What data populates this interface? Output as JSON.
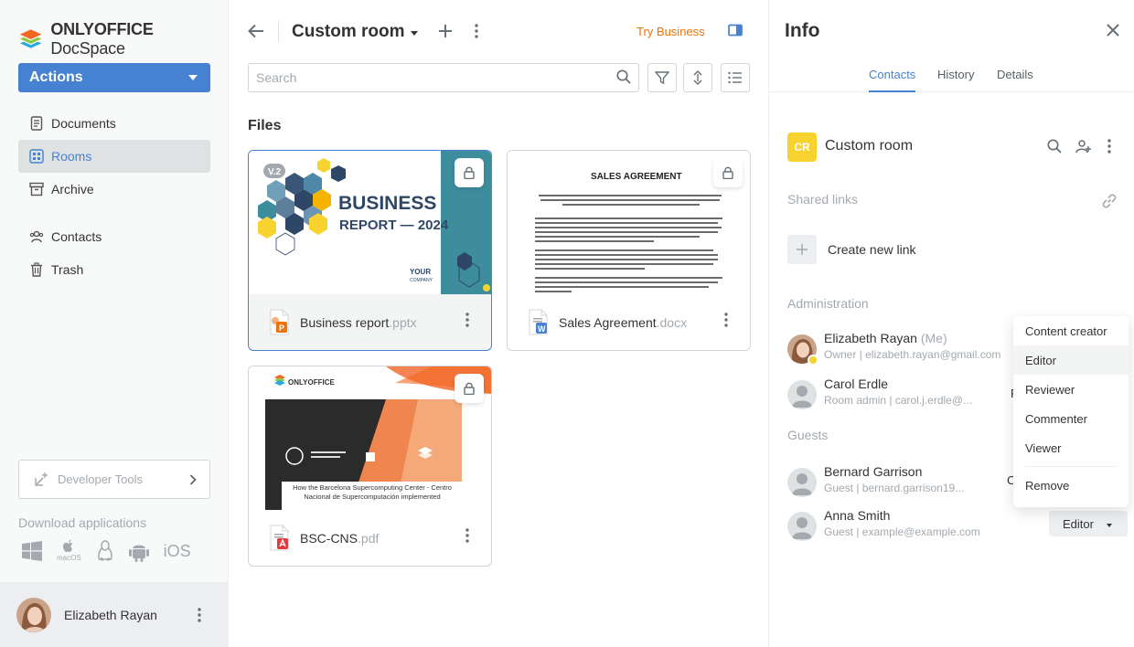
{
  "sidebar": {
    "brand_bold": "ONLYOFFICE",
    "brand_light": "DocSpace",
    "actions_label": "Actions",
    "nav": [
      {
        "label": "Documents",
        "icon": "document-icon"
      },
      {
        "label": "Rooms",
        "icon": "rooms-icon"
      },
      {
        "label": "Archive",
        "icon": "archive-icon"
      },
      {
        "label": "Contacts",
        "icon": "contacts-icon"
      },
      {
        "label": "Trash",
        "icon": "trash-icon"
      }
    ],
    "developer_tools": "Developer Tools",
    "download_label": "Download applications",
    "apps": [
      "windows",
      "macOS",
      "linux",
      "android",
      "iOS"
    ],
    "user_name": "Elizabeth Rayan"
  },
  "main": {
    "room_title": "Custom room",
    "try_business": "Try Business",
    "search_placeholder": "Search",
    "files_heading": "Files",
    "files": [
      {
        "name": "Business report",
        "ext": ".pptx",
        "version": "V.2",
        "thumb": {
          "title1": "BUSINESS",
          "title2": "REPORT — 2024",
          "company1": "YOUR",
          "company2": "COMPANY"
        }
      },
      {
        "name": "Sales Agreement",
        "ext": ".docx",
        "thumb": {
          "title": "SALES AGREEMENT"
        }
      },
      {
        "name": "BSC-CNS",
        "ext": ".pdf",
        "thumb": {
          "logo": "ONLYOFFICE",
          "caption": "How the Barcelona Supercomputing Center - Centro Nacional de Supercomputación implemented"
        }
      }
    ]
  },
  "info": {
    "title": "Info",
    "tabs": [
      "Contacts",
      "History",
      "Details"
    ],
    "room_initials": "CR",
    "room_name": "Custom room",
    "shared_links_title": "Shared links",
    "create_link": "Create new link",
    "administration_title": "Administration",
    "guests_title": "Guests",
    "members": [
      {
        "name": "Elizabeth Rayan",
        "me": "(Me)",
        "sub": "Owner | elizabeth.rayan@gmail.com"
      },
      {
        "name": "Carol Erdle",
        "sub": "Room admin | carol.j.erdle@..."
      },
      {
        "name": "Bernard Garrison",
        "sub": "Guest | bernard.garrison19..."
      },
      {
        "name": "Anna Smith",
        "sub": "Guest | example@example.com"
      }
    ],
    "role_selected": "Editor",
    "peek_letters": [
      "F",
      "C"
    ]
  },
  "role_menu": [
    "Content creator",
    "Editor",
    "Reviewer",
    "Commenter",
    "Viewer",
    "Remove"
  ],
  "colors": {
    "accent": "#4781d1",
    "business": "#ed7309",
    "room_badge": "#f8d22f"
  }
}
